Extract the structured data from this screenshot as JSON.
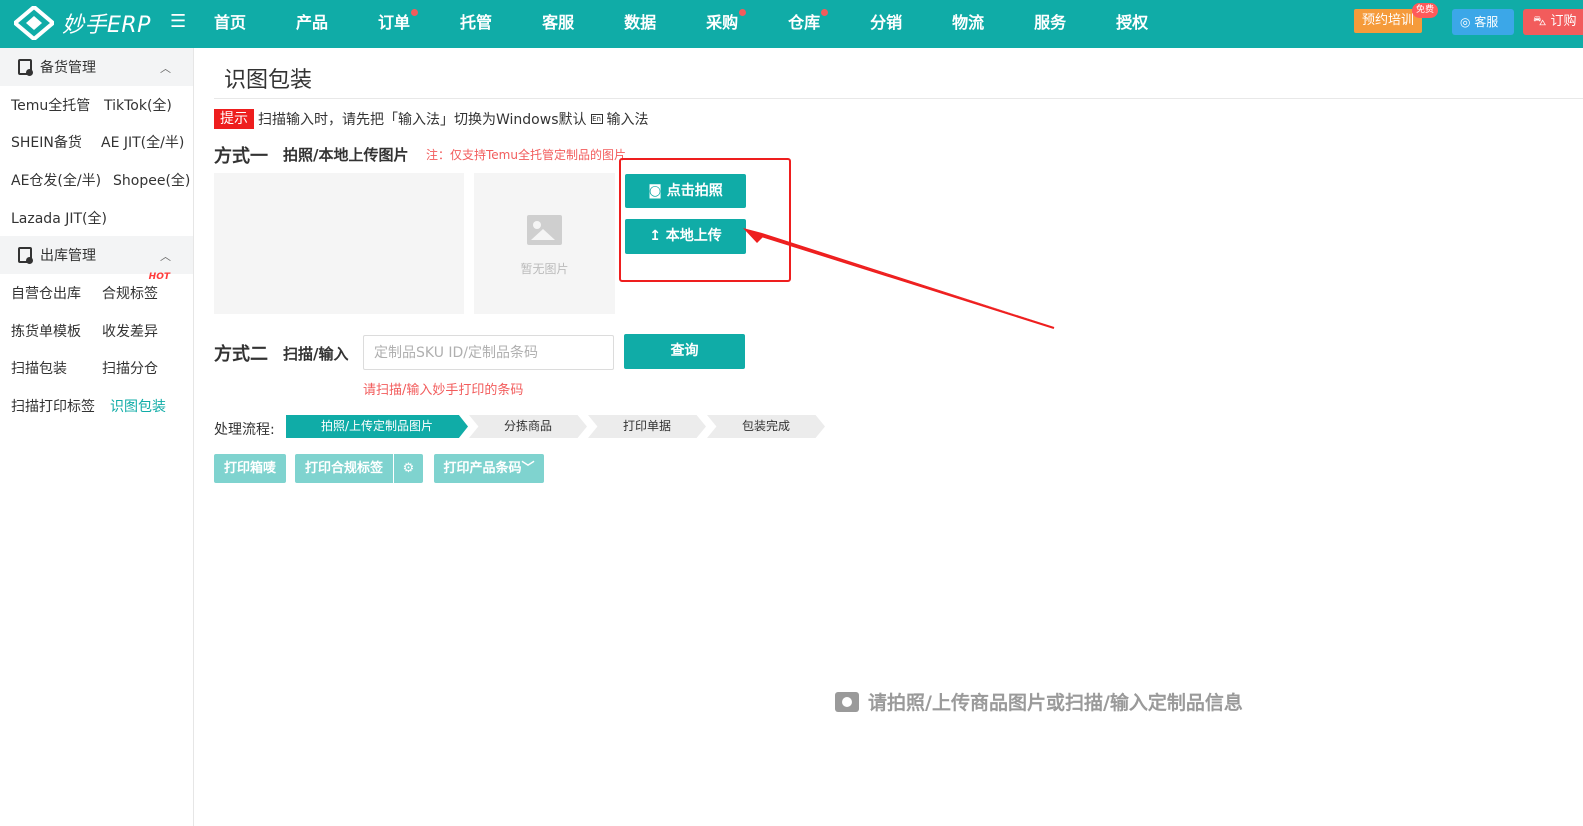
{
  "app": {
    "logo_text": "妙手ERP",
    "icons": {
      "menu_toggle": "menu-toggle-icon",
      "logo": "logo-icon"
    }
  },
  "nav": {
    "items": [
      {
        "label": "首页",
        "dot": false
      },
      {
        "label": "产品",
        "dot": false
      },
      {
        "label": "订单",
        "dot": true
      },
      {
        "label": "托管",
        "dot": false
      },
      {
        "label": "客服",
        "dot": false
      },
      {
        "label": "数据",
        "dot": false
      },
      {
        "label": "采购",
        "dot": true
      },
      {
        "label": "仓库",
        "dot": true
      },
      {
        "label": "分销",
        "dot": false
      },
      {
        "label": "物流",
        "dot": false
      },
      {
        "label": "服务",
        "dot": false
      },
      {
        "label": "授权",
        "dot": false
      }
    ],
    "training_label": "预约培训",
    "free_badge": "免费",
    "service_label": "客服",
    "order_label": "订购"
  },
  "sidebar": {
    "groups": [
      {
        "title": "备货管理",
        "rows": [
          [
            "Temu全托管",
            "TikTok(全)"
          ],
          [
            "SHEIN备货",
            "AE JIT(全/半)"
          ],
          [
            "AE仓发(全/半)",
            "Shopee(全)"
          ],
          [
            "Lazada JIT(全)"
          ]
        ]
      },
      {
        "title": "出库管理",
        "rows": [
          [
            "自营仓出库",
            "合规标签"
          ],
          [
            "拣货单模板",
            "收发差异"
          ],
          [
            "扫描包装",
            "扫描分仓"
          ],
          [
            "扫描打印标签",
            "识图包装"
          ]
        ]
      }
    ],
    "hot_badge": "HOT",
    "active_item": "识图包装"
  },
  "main": {
    "title": "识图包装",
    "hint_tag": "提示",
    "hint_text_before": "扫描输入时，请先把「输入法」切换为Windows默认",
    "hint_text_after": "输入法",
    "method1": {
      "label": "方式一",
      "sub": "拍照/本地上传图片",
      "note": "注：仅支持Temu全托管定制品的图片",
      "placeholder_text": "暂无图片",
      "photo_button": "点击拍照",
      "upload_button": "本地上传"
    },
    "method2": {
      "label": "方式二",
      "sub": "扫描/输入",
      "input_placeholder": "定制品SKU ID/定制品条码",
      "input_value": "",
      "query_button": "查询",
      "input_hint": "请扫描/输入妙手打印的条码"
    },
    "flow": {
      "label": "处理流程:",
      "steps": [
        "拍照/上传定制品图片",
        "分拣商品",
        "打印单据",
        "包装完成"
      ],
      "current_step": 1
    },
    "actions": {
      "print_label": "打印箱唛",
      "compliance_label": "打印合规标签",
      "barcode_label": "打印产品条码"
    },
    "empty_state": "请拍照/上传商品图片或扫描/输入定制品信息"
  },
  "colors": {
    "primary": "#10aca7",
    "danger": "#ee1e1e",
    "light_primary": "#7fd3cf"
  }
}
